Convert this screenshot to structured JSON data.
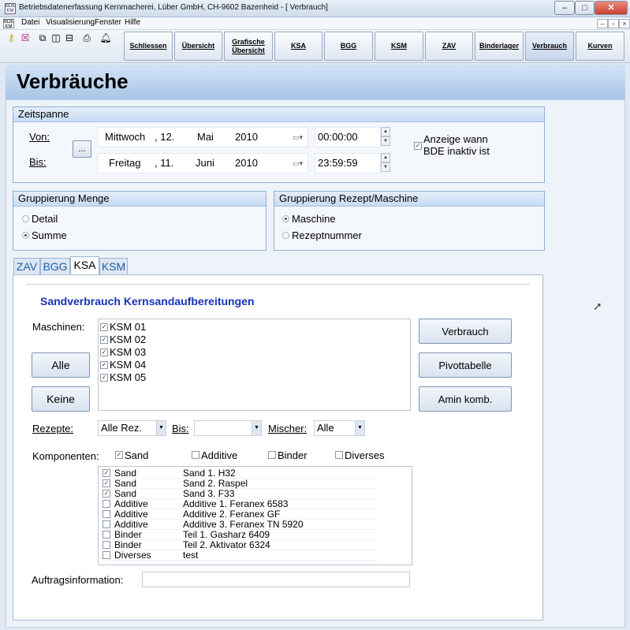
{
  "window": {
    "title": "Betriebsdatenerfassung Kernmacherei, Lüber GmbH, CH-9602 Bazenheid - [ Verbrauch]",
    "minimize": "–",
    "maximize": "□",
    "close": "✕"
  },
  "menu": {
    "items": [
      "Datei",
      "Visualisierung",
      "Fenster",
      "Hilfe"
    ],
    "mdi": [
      "–",
      "▫",
      "×"
    ]
  },
  "toolbar": {
    "buttons": [
      "Schliessen",
      "Übersicht",
      "Grafische\nÜbersicht",
      "KSA",
      "BGG",
      "KSM",
      "ZAV",
      "Binderlager",
      "Verbrauch",
      "Kurven"
    ]
  },
  "header": {
    "title": "Verbräuche"
  },
  "zeitspanne": {
    "title": "Zeitspanne",
    "von_label": "Von:",
    "bis_label": "Bis:",
    "picker_button": "...",
    "von": {
      "weekday": "Mittwoch",
      "day": ", 12.",
      "month": "Mai",
      "year": "2010",
      "time": "00:00:00"
    },
    "bis": {
      "weekday": "Freitag",
      "day": ", 11.",
      "month": "Juni",
      "year": "2010",
      "time": "23:59:59"
    },
    "bde_check_label": "Anzeige wann\nBDE inaktiv ist"
  },
  "gruppierung_menge": {
    "title": "Gruppierung Menge",
    "options": [
      "Detail",
      "Summe"
    ],
    "selected": "Summe"
  },
  "gruppierung_rezept": {
    "title": "Gruppierung Rezept/Maschine",
    "options": [
      "Maschine",
      "Rezeptnummer"
    ],
    "selected": "Maschine"
  },
  "tabs": [
    "ZAV",
    "BGG",
    "KSA",
    "KSM"
  ],
  "active_tab": "KSA",
  "ksa": {
    "heading": "Sandverbrauch Kernsandaufbereitungen",
    "maschinen_label": "Maschinen:",
    "maschinen": [
      "KSM 01",
      "KSM 02",
      "KSM 03",
      "KSM 04",
      "KSM 05"
    ],
    "alle_button": "Alle",
    "keine_button": "Keine",
    "verbrauch_button": "Verbrauch",
    "pivot_button": "Pivottabelle",
    "amin_button": "Amin komb.",
    "rezepte_label": "Rezepte:",
    "rezepte_value": "Alle Rez.",
    "bis_label": "Bis:",
    "bis_value": "",
    "mischer_label": "Mischer:",
    "mischer_value": "Alle",
    "komponenten_label": "Komponenten:",
    "komponenten_filters": [
      "Sand",
      "Additive",
      "Binder",
      "Diverses"
    ],
    "komponenten": [
      {
        "type": "Sand",
        "name": "Sand 1. H32",
        "checked": true
      },
      {
        "type": "Sand",
        "name": "Sand 2. Raspel",
        "checked": true
      },
      {
        "type": "Sand",
        "name": "Sand 3. F33",
        "checked": true
      },
      {
        "type": "Additive",
        "name": "Additive 1. Feranex 6583",
        "checked": false
      },
      {
        "type": "Additive",
        "name": "Additive 2. Feranex GF",
        "checked": false
      },
      {
        "type": "Additive",
        "name": "Additive 3. Feranex TN 5920",
        "checked": false
      },
      {
        "type": "Binder",
        "name": "Teil 1. Gasharz 6409",
        "checked": false
      },
      {
        "type": "Binder",
        "name": "Teil 2. Aktivator 6324",
        "checked": false
      },
      {
        "type": "Diverses",
        "name": "test",
        "checked": false
      }
    ],
    "auftrag_label": "Auftragsinformation:",
    "auftrag_value": ""
  }
}
